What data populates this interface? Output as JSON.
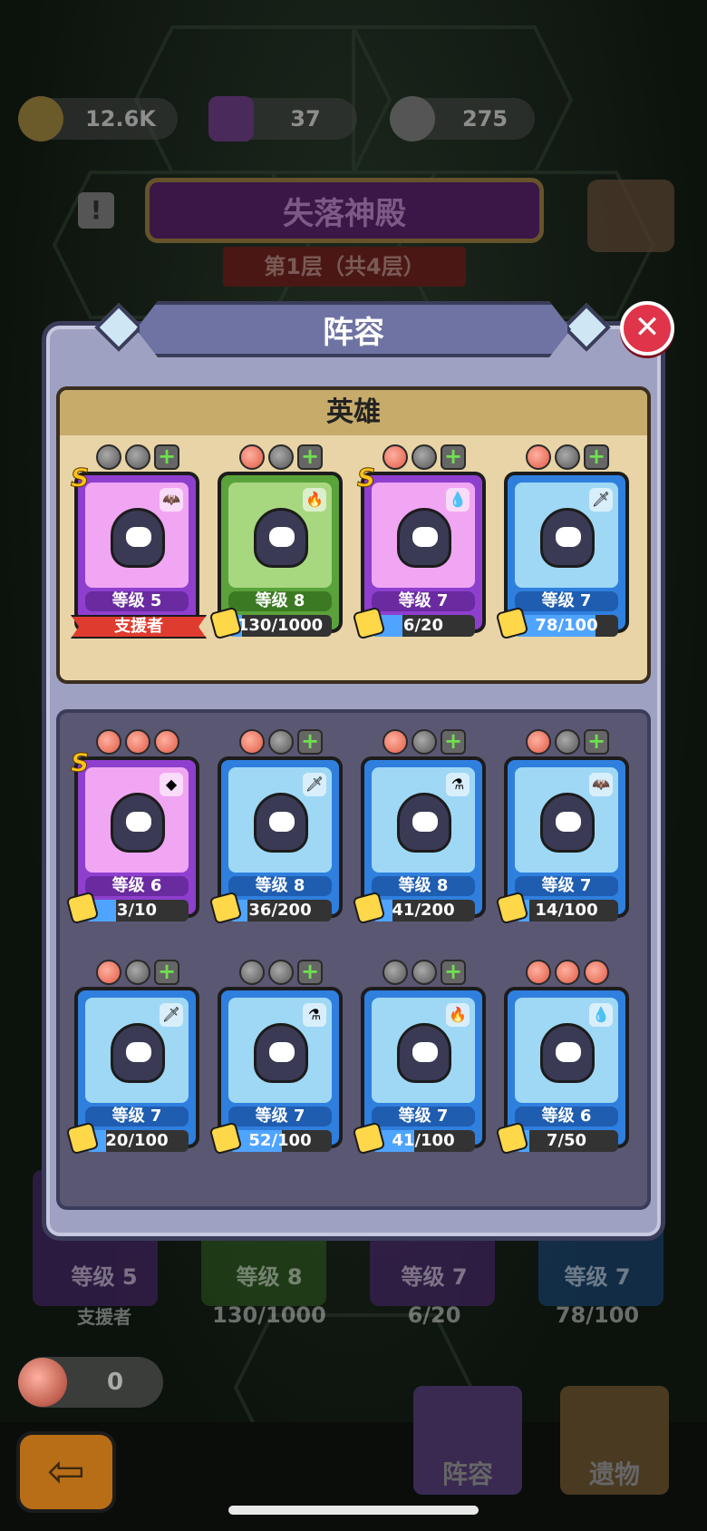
{
  "resources": {
    "gold": "12.6K",
    "gems": "37",
    "pets": "275"
  },
  "map": {
    "title": "失落神殿",
    "floor": "第1层（共4层）"
  },
  "modal": {
    "title": "阵容",
    "hero_section_title": "英雄",
    "heroes": [
      {
        "level": "等级 5",
        "progress": "",
        "progress_fraction": 0,
        "rarity": "S",
        "frame": "purple",
        "element": "bat",
        "badge": "支援者",
        "meats": [
          "bomb",
          "bomb",
          "plus"
        ]
      },
      {
        "level": "等级 8",
        "progress": "130/1000",
        "progress_fraction": 0.13,
        "rarity": "",
        "frame": "green",
        "element": "fire",
        "meats": [
          "meat",
          "bomb",
          "plus"
        ]
      },
      {
        "level": "等级 7",
        "progress": "6/20",
        "progress_fraction": 0.3,
        "rarity": "S",
        "frame": "purple",
        "element": "water",
        "meats": [
          "meat",
          "bomb",
          "plus"
        ]
      },
      {
        "level": "等级 7",
        "progress": "78/100",
        "progress_fraction": 0.78,
        "rarity": "",
        "frame": "blue",
        "element": "sword",
        "meats": [
          "meat",
          "bomb",
          "plus"
        ]
      }
    ],
    "roster": [
      {
        "level": "等级 6",
        "progress": "3/10",
        "progress_fraction": 0.3,
        "rarity": "S",
        "frame": "purple",
        "element": "rock",
        "meats": [
          "meat",
          "meat",
          "meat"
        ]
      },
      {
        "level": "等级 8",
        "progress": "36/200",
        "progress_fraction": 0.18,
        "rarity": "",
        "frame": "blue",
        "element": "sword",
        "meats": [
          "meat",
          "bomb",
          "plus"
        ]
      },
      {
        "level": "等级 8",
        "progress": "41/200",
        "progress_fraction": 0.2,
        "rarity": "",
        "frame": "blue",
        "element": "potion",
        "meats": [
          "meat",
          "bomb",
          "plus"
        ]
      },
      {
        "level": "等级 7",
        "progress": "14/100",
        "progress_fraction": 0.14,
        "rarity": "",
        "frame": "blue",
        "element": "bat",
        "meats": [
          "meat",
          "bomb",
          "plus"
        ]
      },
      {
        "level": "等级 7",
        "progress": "20/100",
        "progress_fraction": 0.2,
        "rarity": "",
        "frame": "blue",
        "element": "sword",
        "meats": [
          "meat",
          "bomb",
          "plus"
        ]
      },
      {
        "level": "等级 7",
        "progress": "52/100",
        "progress_fraction": 0.52,
        "rarity": "",
        "frame": "blue",
        "element": "potion",
        "meats": [
          "bomb",
          "bomb",
          "plus"
        ]
      },
      {
        "level": "等级 7",
        "progress": "41/100",
        "progress_fraction": 0.41,
        "rarity": "",
        "frame": "blue",
        "element": "fire",
        "meats": [
          "bomb",
          "bomb",
          "plus"
        ]
      },
      {
        "level": "等级 6",
        "progress": "7/50",
        "progress_fraction": 0.14,
        "rarity": "",
        "frame": "blue",
        "element": "water",
        "meats": [
          "meat",
          "meat",
          "meat"
        ]
      }
    ]
  },
  "background_team": [
    {
      "level": "等级 5",
      "badge": "支援者"
    },
    {
      "level": "等级 8",
      "progress": "130/1000"
    },
    {
      "level": "等级 7",
      "progress": "6/20"
    },
    {
      "level": "等级 7",
      "progress": "78/100"
    }
  ],
  "meat_count": "0",
  "tabs": {
    "team": "阵容",
    "relics": "遗物"
  },
  "colors": {
    "purple": "#8f3fce",
    "green": "#5aa23a",
    "blue": "#2f7fde",
    "close": "#e0344a"
  }
}
